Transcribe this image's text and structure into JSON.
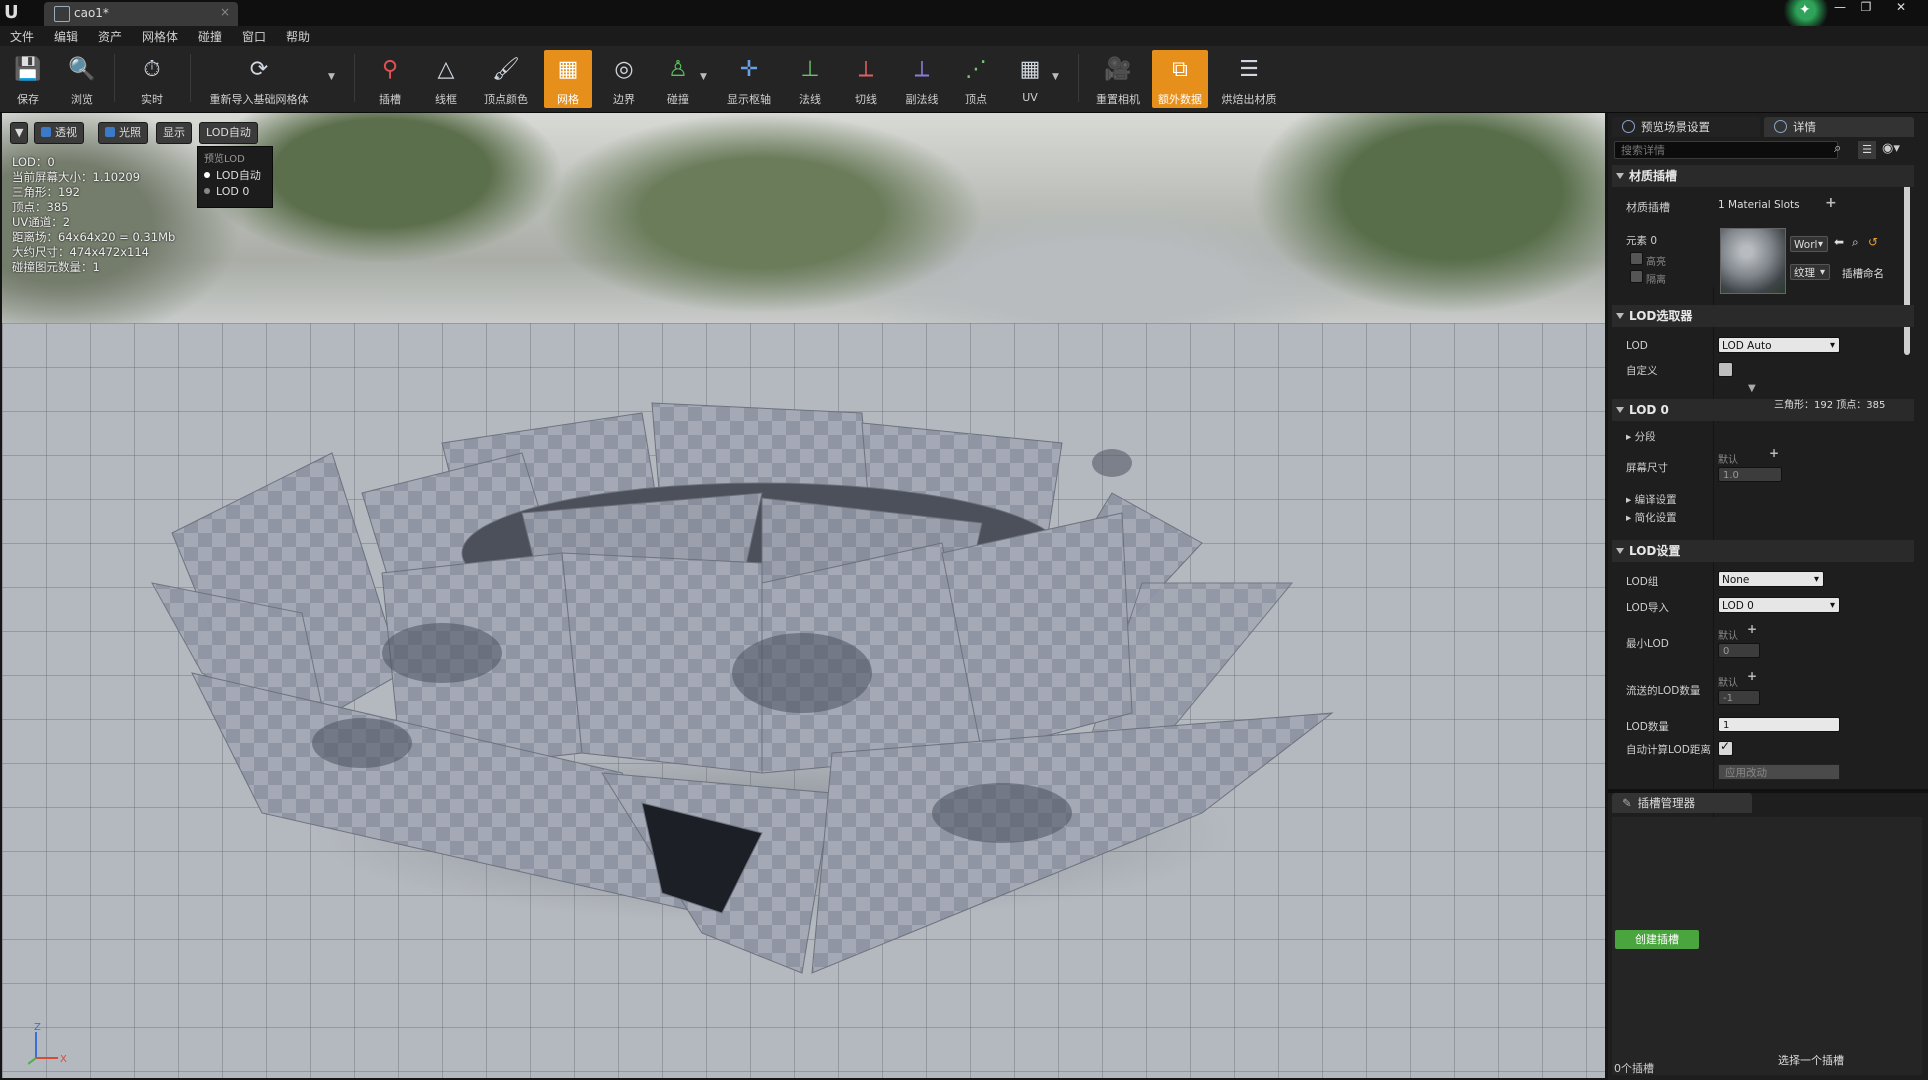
{
  "title_bar": {
    "tab_label": "cao1*",
    "tab_close": "×",
    "help_glyph": "✦",
    "window_buttons": [
      "—",
      "❐",
      "✕"
    ]
  },
  "menu": [
    "文件",
    "编辑",
    "资产",
    "网格体",
    "碰撞",
    "窗口",
    "帮助"
  ],
  "toolbar": {
    "save": "保存",
    "browse": "浏览",
    "realtime": "实时",
    "reimport": "重新导入基础网格体",
    "socket": "插槽",
    "wireframe": "线框",
    "vertex_color": "顶点颜色",
    "mesh": "网格",
    "bounds": "边界",
    "collision": "碰撞",
    "show_pivot": "显示枢轴",
    "normals": "法线",
    "tangents": "切线",
    "binormals": "副法线",
    "vertices": "顶点",
    "uv": "UV",
    "reset_camera": "重置相机",
    "extra_data": "额外数据",
    "bake_material": "烘焙出材质"
  },
  "viewport": {
    "btn_perspective": "透视",
    "btn_lit": "光照",
    "btn_show": "显示",
    "btn_lod": "LOD自动",
    "lod_menu_header": "预览LOD",
    "lod_options": [
      "LOD自动",
      "LOD 0"
    ],
    "stats": [
      "LOD：0",
      "当前屏幕大小：1.10209",
      "三角形：192",
      "顶点：385",
      "UV通道：2",
      "距离场：64x64x20 = 0.31Mb",
      "大约尺寸：474x472x114",
      "碰撞图元数量：1"
    ],
    "axis_z": "Z",
    "axis_x": "X"
  },
  "panel_tabs": {
    "preview_settings": "预览场景设置",
    "details": "详情"
  },
  "details": {
    "search_placeholder": "搜索详情",
    "material_section": "材质插槽",
    "material_slots_label": "材质插槽",
    "material_slots_value": "1 Material Slots",
    "element_label": "元素 0",
    "highlight": "高亮",
    "isolate": "隔离",
    "world_dd": "Worl",
    "texture_dd": "纹理",
    "slot_name": "插槽命名",
    "lod_picker_section": "LOD选取器",
    "lod_label": "LOD",
    "lod_value": "LOD Auto",
    "custom_label": "自定义",
    "lod0_section": "LOD 0",
    "tri_vert_info": "三角形：192   顶点：385",
    "sections_label": "分段",
    "screen_size_label": "屏幕尺寸",
    "default_label": "默认",
    "screen_size_value": "1.0",
    "build_settings": "编译设置",
    "reduction_settings": "简化设置",
    "lod_settings_section": "LOD设置",
    "lod_group_label": "LOD组",
    "lod_group_value": "None",
    "lod_import_label": "LOD导入",
    "lod_import_value": "LOD 0",
    "min_lod_label": "最小LOD",
    "min_lod_value": "0",
    "streamed_lod_label": "流送的LOD数量",
    "streamed_lod_value": "-1",
    "num_lods_label": "LOD数量",
    "num_lods_value": "1",
    "auto_lod_label": "自动计算LOD距离",
    "apply_changes": "应用改动"
  },
  "socket_manager": {
    "tab": "插槽管理器",
    "create_btn": "创建插槽",
    "select_hint": "选择一个插槽",
    "count": "0个插槽"
  }
}
